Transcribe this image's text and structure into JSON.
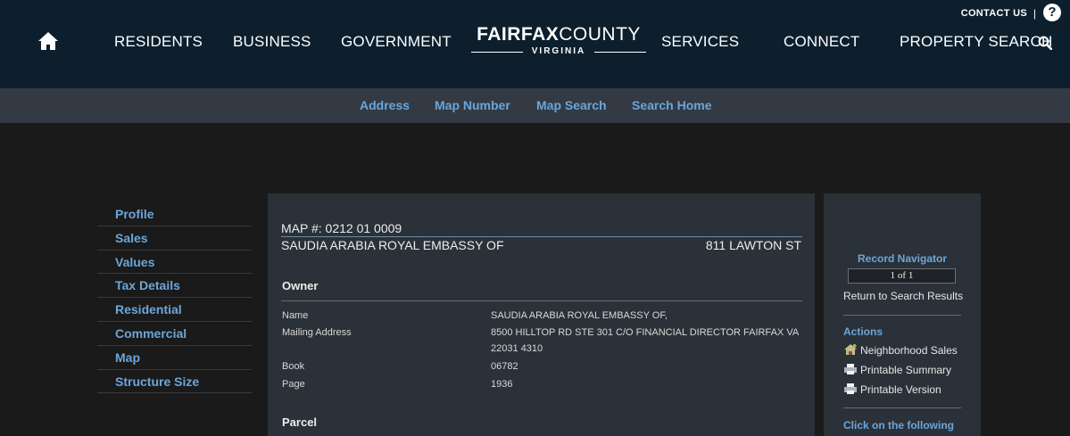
{
  "header": {
    "contact_label": "CONTACT US",
    "separator": "|",
    "help_glyph": "?",
    "nav": [
      "RESIDENTS",
      "BUSINESS",
      "GOVERNMENT",
      "SERVICES",
      "CONNECT",
      "PROPERTY SEARCH"
    ],
    "logo": {
      "main_bold": "FAIRFAX",
      "main_light": "COUNTY",
      "sub": "VIRGINIA"
    },
    "icons": {
      "home": "home-icon",
      "search": "search-icon",
      "help": "help-icon"
    }
  },
  "subnav": [
    "Address",
    "Map Number",
    "Map Search",
    "Search Home"
  ],
  "sidebar": [
    "Profile",
    "Sales",
    "Values",
    "Tax Details",
    "Residential",
    "Commercial",
    "Map",
    "Structure Size"
  ],
  "record": {
    "map_number": "MAP #: 0212 01 0009",
    "owner_name": "SAUDIA ARABIA ROYAL EMBASSY OF",
    "address": "811 LAWTON ST"
  },
  "owner": {
    "title": "Owner",
    "rows": [
      {
        "label": "Name",
        "value": "SAUDIA ARABIA ROYAL EMBASSY OF,"
      },
      {
        "label": "Mailing Address",
        "value": "8500 HILLTOP RD STE 301 C/O FINANCIAL DIRECTOR FAIRFAX VA 22031 4310"
      },
      {
        "label": "Book",
        "value": "06782"
      },
      {
        "label": "Page",
        "value": "1936"
      }
    ]
  },
  "parcel": {
    "title": "Parcel"
  },
  "right_panel": {
    "record_navigator_title": "Record Navigator",
    "record_position": "1 of 1",
    "return_link": "Return to Search Results",
    "actions_title": "Actions",
    "actions": [
      {
        "label": "Neighborhood Sales",
        "icon": "neighborhood-icon"
      },
      {
        "label": "Printable Summary",
        "icon": "printer-icon"
      },
      {
        "label": "Printable Version",
        "icon": "printer-icon"
      }
    ],
    "click_following": "Click on the following"
  },
  "colors": {
    "header_bg": "#0d1f2d",
    "subnav_bg": "#333a44",
    "page_bg": "#1a1a1a",
    "panel_bg": "#2b3138",
    "link": "#6ba6d9"
  }
}
